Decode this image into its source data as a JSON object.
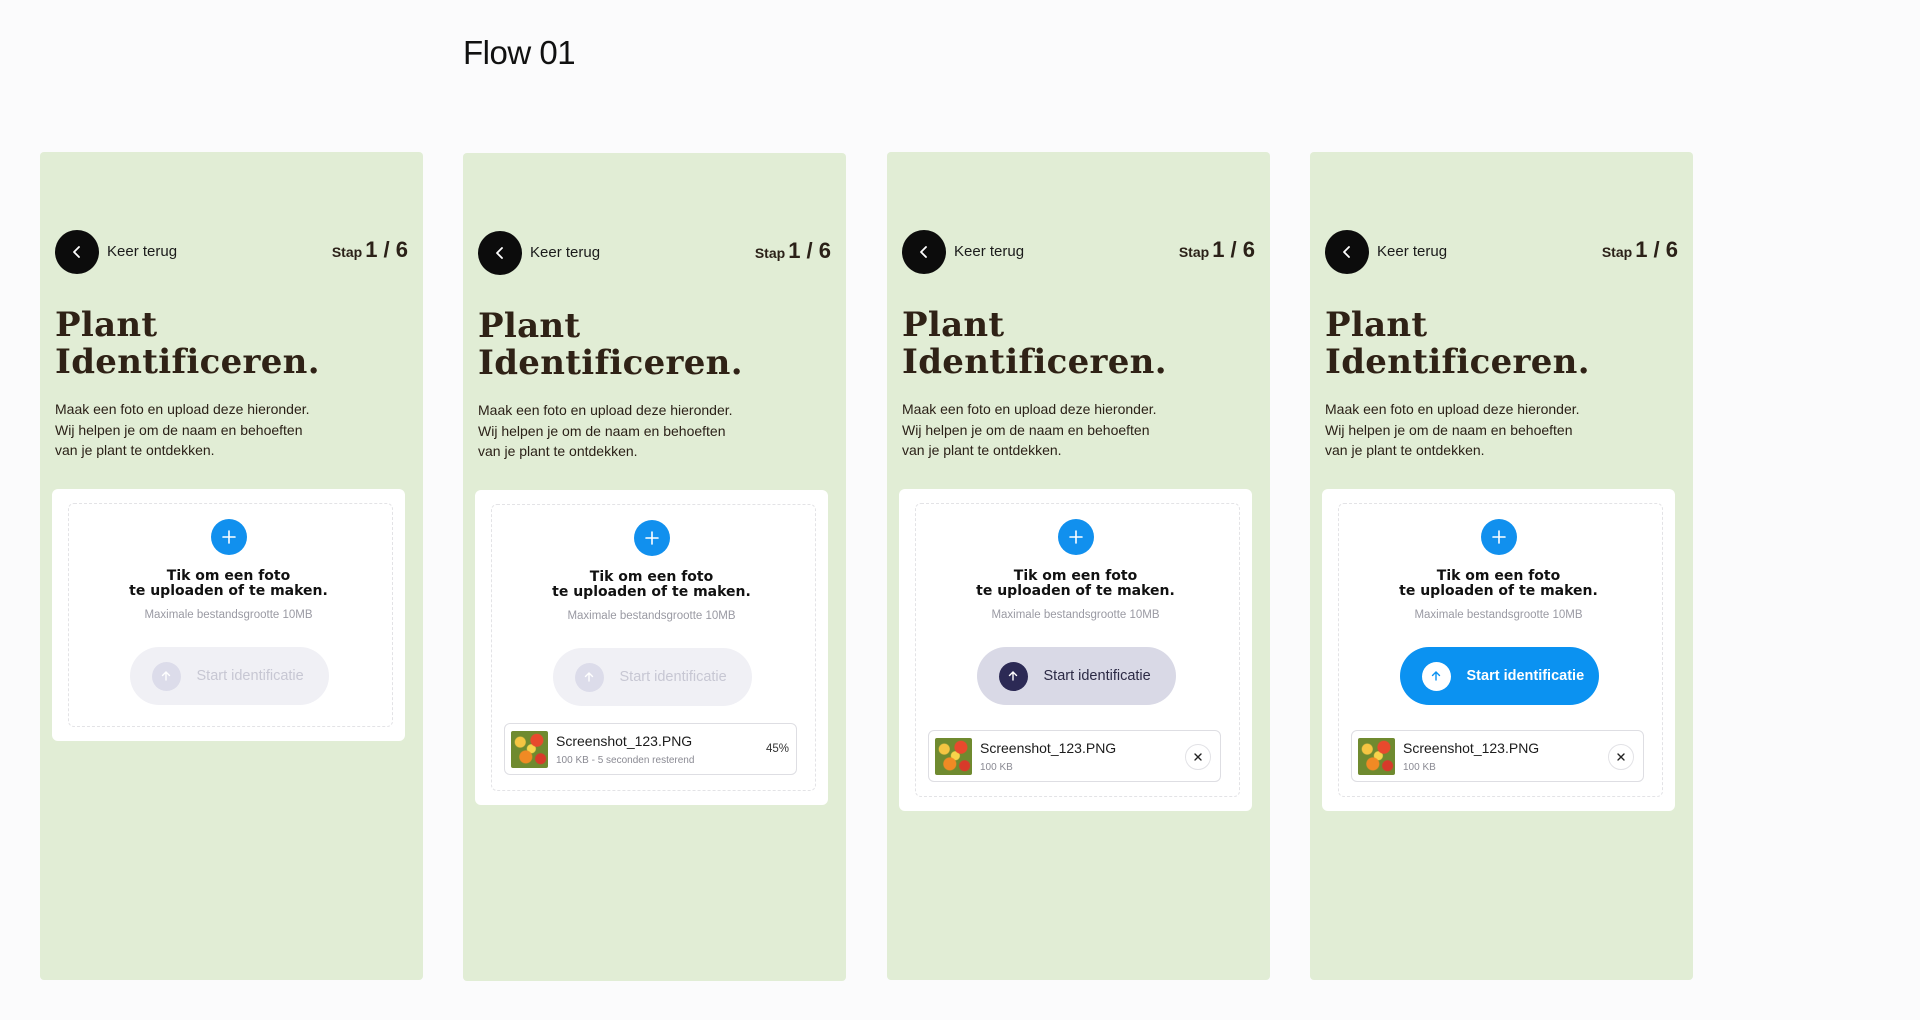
{
  "flow_title": "Flow 01",
  "colors": {
    "screen_bg": "#e1edd5",
    "accent_blue": "#0b92f1",
    "heading": "#2f2216",
    "pressed_dark": "#2c2a55"
  },
  "common": {
    "back_label": "Keer terug",
    "step_word": "Stap",
    "step_value": "1 / 6",
    "heading_line1": "Plant",
    "heading_line2": "Identificeren.",
    "desc_line1": "Maak een foto en upload deze hieronder.",
    "desc_line2": "Wij helpen je om de naam en behoeften",
    "desc_line3": "van je plant te ontdekken.",
    "tap_line1": "Tik om een foto",
    "tap_line2": "te uploaden of te maken.",
    "max_size": "Maximale bestandsgrootte 10MB",
    "start_label": "Start identificatie",
    "icons": {
      "back": "chevron-left-icon",
      "add": "plus-icon",
      "upload": "arrow-up-icon",
      "remove": "close-icon"
    }
  },
  "screens": [
    {
      "state": "empty",
      "button_state": "disabled",
      "file": null
    },
    {
      "state": "uploading",
      "button_state": "disabled",
      "file": {
        "name": "Screenshot_123.PNG",
        "meta": "100 KB - 5 seconden resterend",
        "progress": "45%"
      }
    },
    {
      "state": "uploaded",
      "button_state": "pressed",
      "file": {
        "name": "Screenshot_123.PNG",
        "meta": "100 KB"
      }
    },
    {
      "state": "ready",
      "button_state": "active",
      "file": {
        "name": "Screenshot_123.PNG",
        "meta": "100 KB"
      }
    }
  ]
}
